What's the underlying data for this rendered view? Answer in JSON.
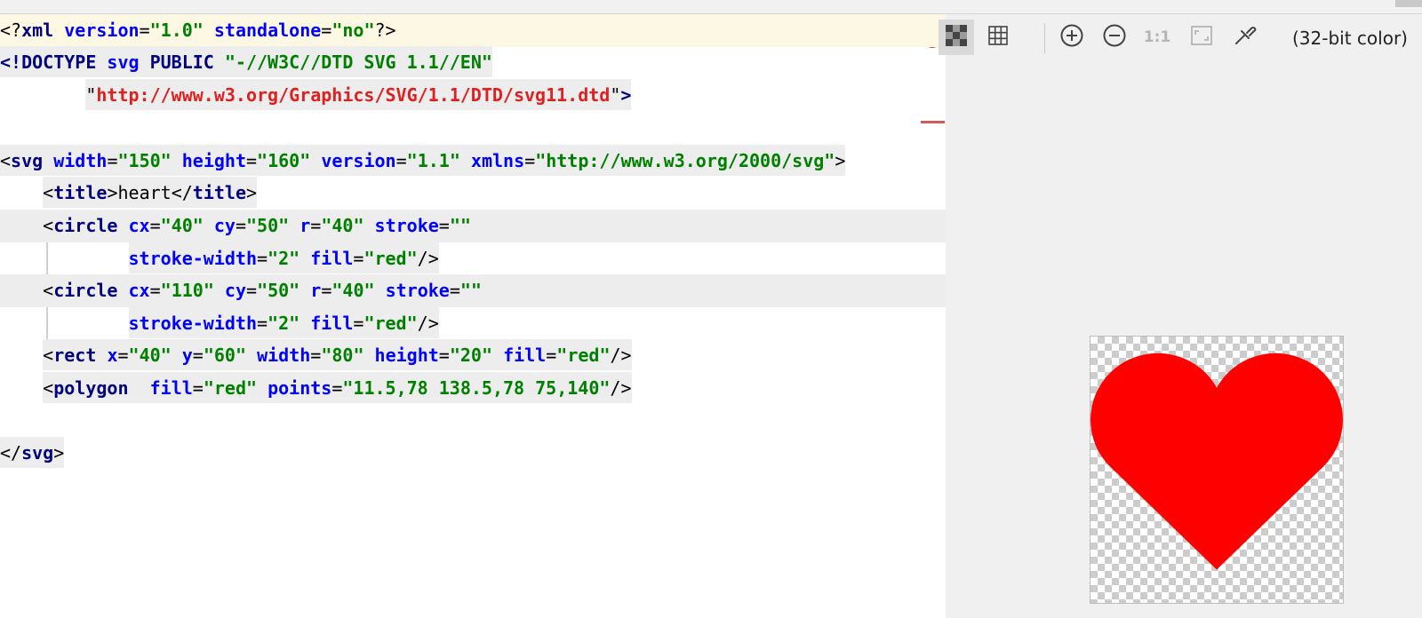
{
  "editor": {
    "lines": [
      [
        {
          "t": "<?",
          "c": "c-punct"
        },
        {
          "t": "xml",
          "c": "c-tag"
        },
        {
          "t": " ",
          "c": "c-text"
        },
        {
          "t": "version",
          "c": "c-attr"
        },
        {
          "t": "=",
          "c": "c-punct"
        },
        {
          "t": "\"1.0\"",
          "c": "c-val"
        },
        {
          "t": " ",
          "c": "c-text"
        },
        {
          "t": "standalone",
          "c": "c-attr"
        },
        {
          "t": "=",
          "c": "c-punct"
        },
        {
          "t": "\"no\"",
          "c": "c-val"
        },
        {
          "t": "?>",
          "c": "c-punct"
        }
      ],
      [
        {
          "t": "<!DOCTYPE",
          "c": "c-doctype"
        },
        {
          "t": " ",
          "c": "c-text"
        },
        {
          "t": "svg",
          "c": "c-attr"
        },
        {
          "t": " ",
          "c": "c-text"
        },
        {
          "t": "PUBLIC",
          "c": "c-doctype"
        },
        {
          "t": " ",
          "c": "c-text"
        },
        {
          "t": "\"-//W3C//DTD SVG 1.1//EN\"",
          "c": "c-val"
        }
      ],
      [
        {
          "t": "        ",
          "c": "c-text",
          "nohl": true
        },
        {
          "t": "\"",
          "c": "c-punct"
        },
        {
          "t": "http://www.w3.org/Graphics/SVG/1.1/DTD/svg11.dtd",
          "c": "c-url"
        },
        {
          "t": "\"",
          "c": "c-punct"
        },
        {
          "t": ">",
          "c": "c-tag"
        }
      ],
      [],
      [
        {
          "t": "<",
          "c": "c-punct"
        },
        {
          "t": "svg",
          "c": "c-tag"
        },
        {
          "t": " ",
          "c": "c-text"
        },
        {
          "t": "width",
          "c": "c-attr"
        },
        {
          "t": "=",
          "c": "c-punct"
        },
        {
          "t": "\"150\"",
          "c": "c-val"
        },
        {
          "t": " ",
          "c": "c-text"
        },
        {
          "t": "height",
          "c": "c-attr"
        },
        {
          "t": "=",
          "c": "c-punct"
        },
        {
          "t": "\"160\"",
          "c": "c-val"
        },
        {
          "t": " ",
          "c": "c-text"
        },
        {
          "t": "version",
          "c": "c-attr"
        },
        {
          "t": "=",
          "c": "c-punct"
        },
        {
          "t": "\"1.1\"",
          "c": "c-val"
        },
        {
          "t": " ",
          "c": "c-text"
        },
        {
          "t": "xmlns",
          "c": "c-attr"
        },
        {
          "t": "=",
          "c": "c-punct"
        },
        {
          "t": "\"http://www.w3.org/2000/svg\"",
          "c": "c-val"
        },
        {
          "t": ">",
          "c": "c-punct"
        }
      ],
      [
        {
          "t": "    ",
          "c": "c-text",
          "nohl": true
        },
        {
          "t": "<",
          "c": "c-punct"
        },
        {
          "t": "title",
          "c": "c-tag"
        },
        {
          "t": ">",
          "c": "c-punct"
        },
        {
          "t": "heart",
          "c": "c-text"
        },
        {
          "t": "</",
          "c": "c-punct"
        },
        {
          "t": "title",
          "c": "c-tag"
        },
        {
          "t": ">",
          "c": "c-punct"
        }
      ],
      [
        {
          "t": "    ",
          "c": "c-text",
          "nohl": true
        },
        {
          "t": "<",
          "c": "c-punct"
        },
        {
          "t": "circle",
          "c": "c-tag"
        },
        {
          "t": " ",
          "c": "c-text"
        },
        {
          "t": "cx",
          "c": "c-attr"
        },
        {
          "t": "=",
          "c": "c-punct"
        },
        {
          "t": "\"40\"",
          "c": "c-val"
        },
        {
          "t": " ",
          "c": "c-text"
        },
        {
          "t": "cy",
          "c": "c-attr"
        },
        {
          "t": "=",
          "c": "c-punct"
        },
        {
          "t": "\"50\"",
          "c": "c-val"
        },
        {
          "t": " ",
          "c": "c-text"
        },
        {
          "t": "r",
          "c": "c-attr"
        },
        {
          "t": "=",
          "c": "c-punct"
        },
        {
          "t": "\"40\"",
          "c": "c-val"
        },
        {
          "t": " ",
          "c": "c-text"
        },
        {
          "t": "stroke",
          "c": "c-attr"
        },
        {
          "t": "=",
          "c": "c-punct"
        },
        {
          "t": "\"\"",
          "c": "c-val"
        }
      ],
      [
        {
          "t": "            ",
          "c": "c-text",
          "nohl": true
        },
        {
          "t": "stroke-width",
          "c": "c-attr"
        },
        {
          "t": "=",
          "c": "c-punct"
        },
        {
          "t": "\"2\"",
          "c": "c-val"
        },
        {
          "t": " ",
          "c": "c-text"
        },
        {
          "t": "fill",
          "c": "c-attr"
        },
        {
          "t": "=",
          "c": "c-punct"
        },
        {
          "t": "\"red\"",
          "c": "c-val"
        },
        {
          "t": "/>",
          "c": "c-punct"
        }
      ],
      [
        {
          "t": "    ",
          "c": "c-text",
          "nohl": true
        },
        {
          "t": "<",
          "c": "c-punct"
        },
        {
          "t": "circle",
          "c": "c-tag"
        },
        {
          "t": " ",
          "c": "c-text"
        },
        {
          "t": "cx",
          "c": "c-attr"
        },
        {
          "t": "=",
          "c": "c-punct"
        },
        {
          "t": "\"110\"",
          "c": "c-val"
        },
        {
          "t": " ",
          "c": "c-text"
        },
        {
          "t": "cy",
          "c": "c-attr"
        },
        {
          "t": "=",
          "c": "c-punct"
        },
        {
          "t": "\"50\"",
          "c": "c-val"
        },
        {
          "t": " ",
          "c": "c-text"
        },
        {
          "t": "r",
          "c": "c-attr"
        },
        {
          "t": "=",
          "c": "c-punct"
        },
        {
          "t": "\"40\"",
          "c": "c-val"
        },
        {
          "t": " ",
          "c": "c-text"
        },
        {
          "t": "stroke",
          "c": "c-attr"
        },
        {
          "t": "=",
          "c": "c-punct"
        },
        {
          "t": "\"\"",
          "c": "c-val"
        }
      ],
      [
        {
          "t": "            ",
          "c": "c-text",
          "nohl": true
        },
        {
          "t": "stroke-width",
          "c": "c-attr"
        },
        {
          "t": "=",
          "c": "c-punct"
        },
        {
          "t": "\"2\"",
          "c": "c-val"
        },
        {
          "t": " ",
          "c": "c-text"
        },
        {
          "t": "fill",
          "c": "c-attr"
        },
        {
          "t": "=",
          "c": "c-punct"
        },
        {
          "t": "\"red\"",
          "c": "c-val"
        },
        {
          "t": "/>",
          "c": "c-punct"
        }
      ],
      [
        {
          "t": "    ",
          "c": "c-text",
          "nohl": true
        },
        {
          "t": "<",
          "c": "c-punct"
        },
        {
          "t": "rect",
          "c": "c-tag"
        },
        {
          "t": " ",
          "c": "c-text"
        },
        {
          "t": "x",
          "c": "c-attr"
        },
        {
          "t": "=",
          "c": "c-punct"
        },
        {
          "t": "\"40\"",
          "c": "c-val"
        },
        {
          "t": " ",
          "c": "c-text"
        },
        {
          "t": "y",
          "c": "c-attr"
        },
        {
          "t": "=",
          "c": "c-punct"
        },
        {
          "t": "\"60\"",
          "c": "c-val"
        },
        {
          "t": " ",
          "c": "c-text"
        },
        {
          "t": "width",
          "c": "c-attr"
        },
        {
          "t": "=",
          "c": "c-punct"
        },
        {
          "t": "\"80\"",
          "c": "c-val"
        },
        {
          "t": " ",
          "c": "c-text"
        },
        {
          "t": "height",
          "c": "c-attr"
        },
        {
          "t": "=",
          "c": "c-punct"
        },
        {
          "t": "\"20\"",
          "c": "c-val"
        },
        {
          "t": " ",
          "c": "c-text"
        },
        {
          "t": "fill",
          "c": "c-attr"
        },
        {
          "t": "=",
          "c": "c-punct"
        },
        {
          "t": "\"red\"",
          "c": "c-val"
        },
        {
          "t": "/>",
          "c": "c-punct"
        }
      ],
      [
        {
          "t": "    ",
          "c": "c-text",
          "nohl": true
        },
        {
          "t": "<",
          "c": "c-punct"
        },
        {
          "t": "polygon",
          "c": "c-tag"
        },
        {
          "t": "  ",
          "c": "c-text"
        },
        {
          "t": "fill",
          "c": "c-attr"
        },
        {
          "t": "=",
          "c": "c-punct"
        },
        {
          "t": "\"red\"",
          "c": "c-val"
        },
        {
          "t": " ",
          "c": "c-text"
        },
        {
          "t": "points",
          "c": "c-attr"
        },
        {
          "t": "=",
          "c": "c-punct"
        },
        {
          "t": "\"11.5,78 138.5,78 75,140\"",
          "c": "c-val"
        },
        {
          "t": "/>",
          "c": "c-punct"
        }
      ],
      [],
      [
        {
          "t": "</",
          "c": "c-punct"
        },
        {
          "t": "svg",
          "c": "c-tag"
        },
        {
          "t": ">",
          "c": "c-punct"
        }
      ]
    ]
  },
  "preview": {
    "color_mode": "(32-bit color)",
    "actual_size_label": "1:1",
    "heart_fill": "#ff0000",
    "toolbar": [
      {
        "name": "transparency-background-button",
        "icon": "checker-icon",
        "active": true
      },
      {
        "name": "grid-button",
        "icon": "grid-icon",
        "active": false
      },
      {
        "name": "zoom-in-button",
        "icon": "zoom-in-icon",
        "active": false
      },
      {
        "name": "zoom-out-button",
        "icon": "zoom-out-icon",
        "active": false
      },
      {
        "name": "actual-size-button",
        "icon": "actual-size-icon",
        "active": false
      },
      {
        "name": "fit-to-window-button",
        "icon": "fit-window-icon",
        "active": false
      },
      {
        "name": "color-picker-button",
        "icon": "eyedropper-icon",
        "active": false
      }
    ]
  }
}
